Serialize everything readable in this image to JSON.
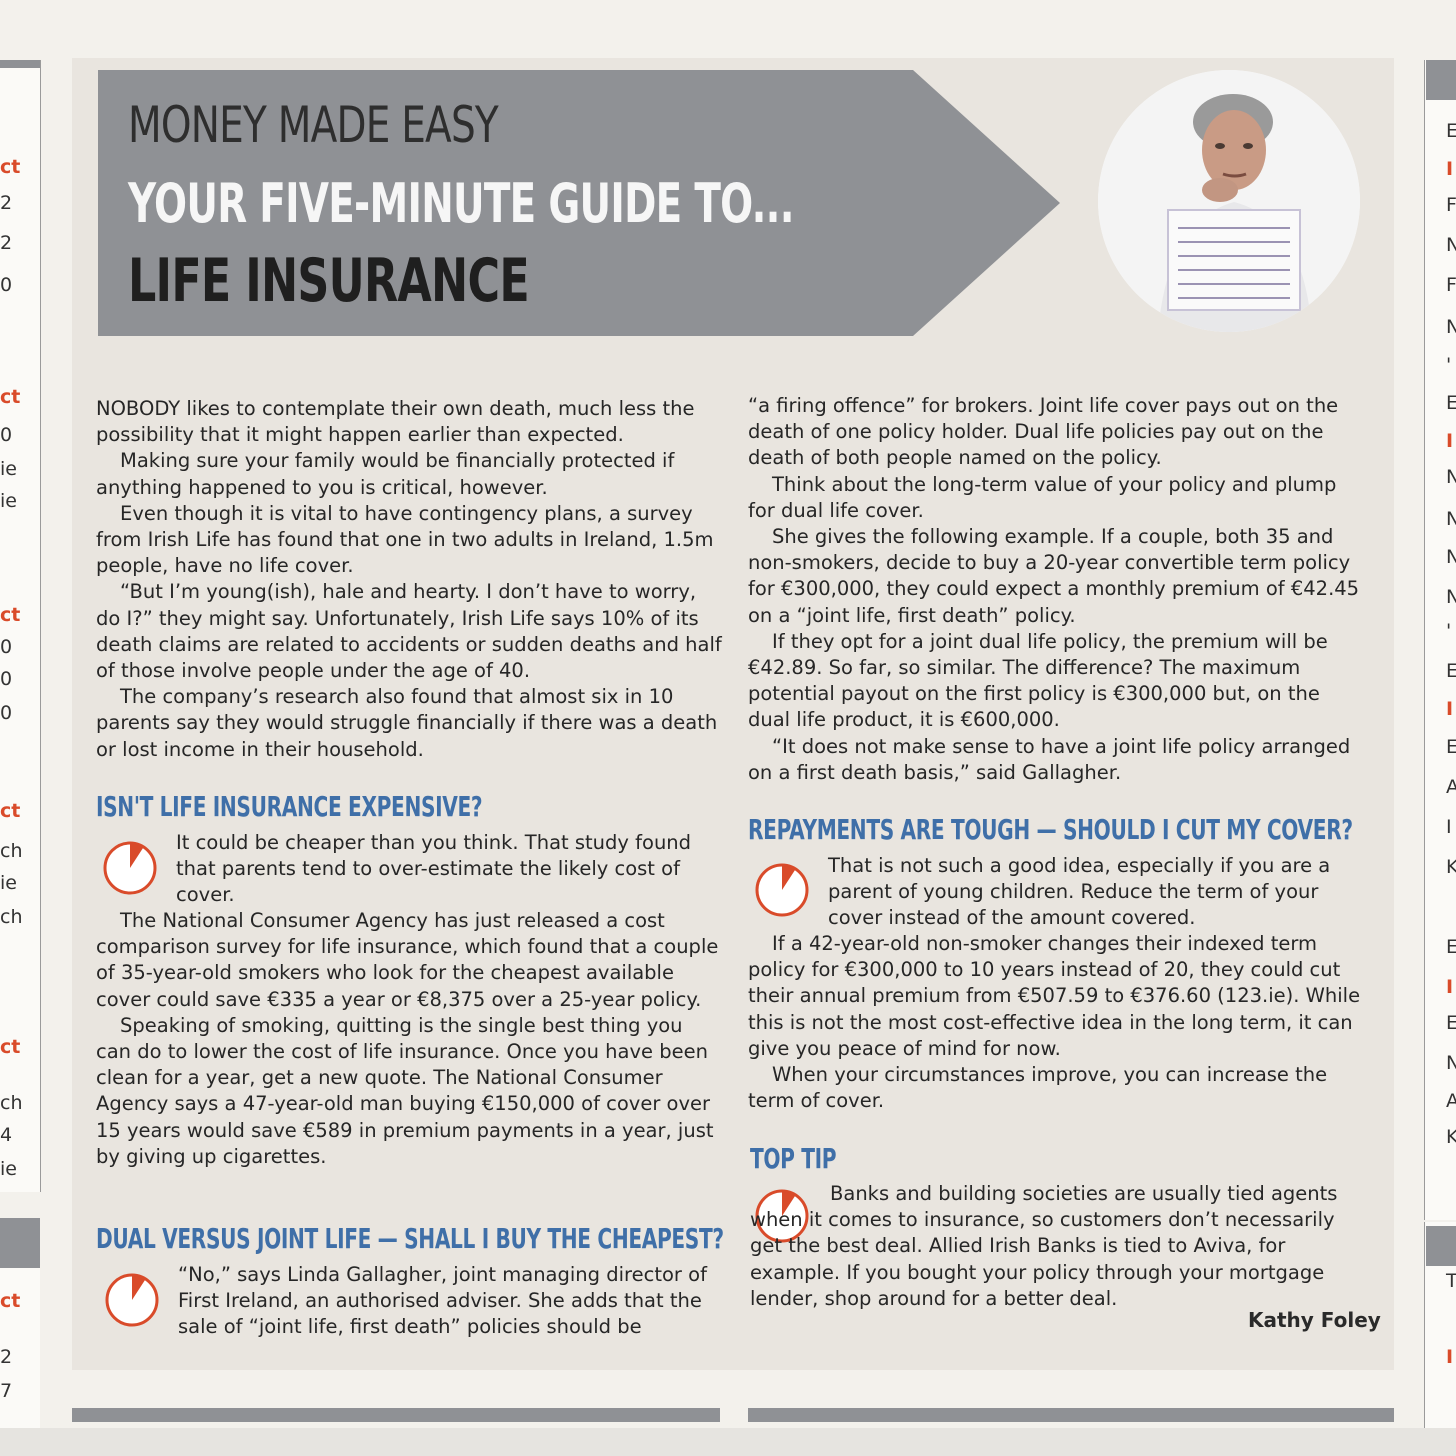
{
  "header": {
    "kicker": "MONEY MADE EASY",
    "title_line1": "YOUR FIVE-MINUTE GUIDE TO...",
    "title_line2": "LIFE INSURANCE"
  },
  "col1": {
    "paragraphs": [
      "NOBODY likes to contemplate their own death, much less the possibility that it might happen earlier than expected.",
      "Making sure your family would be financially protected if anything happened to you is critical, however.",
      "Even though it is vital to have contingency plans, a survey from Irish Life has found that one in two adults in Ireland, 1.5m people, have no life cover.",
      "“But I’m young(ish), hale and hearty. I don’t have to worry, do I?” they might say. Unfortunately, Irish Life says 10% of its death claims are related to accidents or sudden deaths and half of those involve people under the age of 40.",
      "The company’s research also found that almost six in 10 parents say they would struggle financially if there was a death or lost income in their household."
    ],
    "section1": {
      "heading": "ISN'T LIFE INSURANCE EXPENSIVE?",
      "lead": "It could be cheaper than you think. That study found that parents tend to over-estimate the likely cost of cover.",
      "paragraphs": [
        "The National Consumer Agency has just released a cost comparison survey for life insurance, which found that a couple of 35-year-old smokers who look for the cheapest available cover could save €335 a year or €8,375 over a 25-year policy.",
        "Speaking of smoking, quitting is the single best thing you can do to lower the cost of life insurance. Once you have been clean for a year, get a new quote. The National Consumer Agency says a 47-year-old man buying €150,000 of cover over 15 years would save €589 in premium payments in a year, just by giving up cigarettes."
      ]
    },
    "section2": {
      "heading": "DUAL VERSUS JOINT LIFE — SHALL I BUY THE CHEAPEST?",
      "lead": "“No,” says Linda Gallagher, joint managing director of First Ireland, an authorised adviser. She adds that the sale of “joint life, first death” policies should be"
    }
  },
  "col2": {
    "paragraphs": [
      "“a firing offence” for brokers. Joint life cover pays out on the death of one policy holder. Dual life policies pay out on the death of both people named on the policy.",
      "Think about the long-term value of your policy and plump for dual life cover.",
      "She gives the following example. If a couple, both 35 and non-smokers, decide to buy a 20-year convertible term policy for €300,000, they could expect a monthly premium of €42.45 on a “joint life, first death” policy.",
      "If they opt for a joint dual life policy, the premium will be €42.89. So far, so similar. The difference? The maximum potential payout on the first policy is €300,000 but, on the dual life product, it is €600,000.",
      "“It does not make sense to have a joint life policy arranged on a first death basis,” said Gallagher."
    ],
    "section3": {
      "heading": "REPAYMENTS ARE TOUGH — SHOULD I CUT MY COVER?",
      "lead": "That is not such a good idea, especially if you are a parent of young children. Reduce the term of your cover instead of the amount covered.",
      "paragraphs": [
        "If a 42-year-old non-smoker changes their indexed term policy for €300,000 to 10 years instead of 20, they could cut their annual premium from €507.59 to €376.60 (123.ie). While this is not the most cost-effective idea in the long term, it can give you peace of mind for now.",
        "When your circumstances improve, you can increase the term of cover."
      ]
    },
    "section4": {
      "heading": "TOP TIP",
      "lead": "Banks and building societies are usually tied agents when it comes to insurance, so customers don’t necessarily get the best deal. Allied Irish Banks is tied to Aviva, for example. If you bought your policy through your mortgage lender, shop around for a better deal."
    },
    "byline": "Kathy Foley"
  },
  "left_fragments": [
    "ct",
    "2",
    "2",
    "0",
    "ct",
    "0",
    "ie",
    "ie",
    "ct",
    "0",
    "0",
    "0",
    "ct",
    "ch",
    "ie",
    "ch",
    "ct",
    "ch",
    "4",
    "ie",
    "ct",
    "2",
    "7"
  ],
  "right_fragments": [
    "E",
    "I",
    "F",
    "N",
    "F",
    "N",
    "'",
    "E",
    "I",
    "N",
    "N",
    "N",
    "N",
    "'",
    "E",
    "I",
    "E",
    "A",
    "I",
    "K",
    "E",
    "I",
    "E",
    "N",
    "A",
    "K",
    "T",
    "I"
  ],
  "colors": {
    "accent_blue": "#3f6fa8",
    "accent_red": "#d94b2a",
    "banner_grey": "#8f9195"
  },
  "icons": [
    "clock-icon"
  ]
}
